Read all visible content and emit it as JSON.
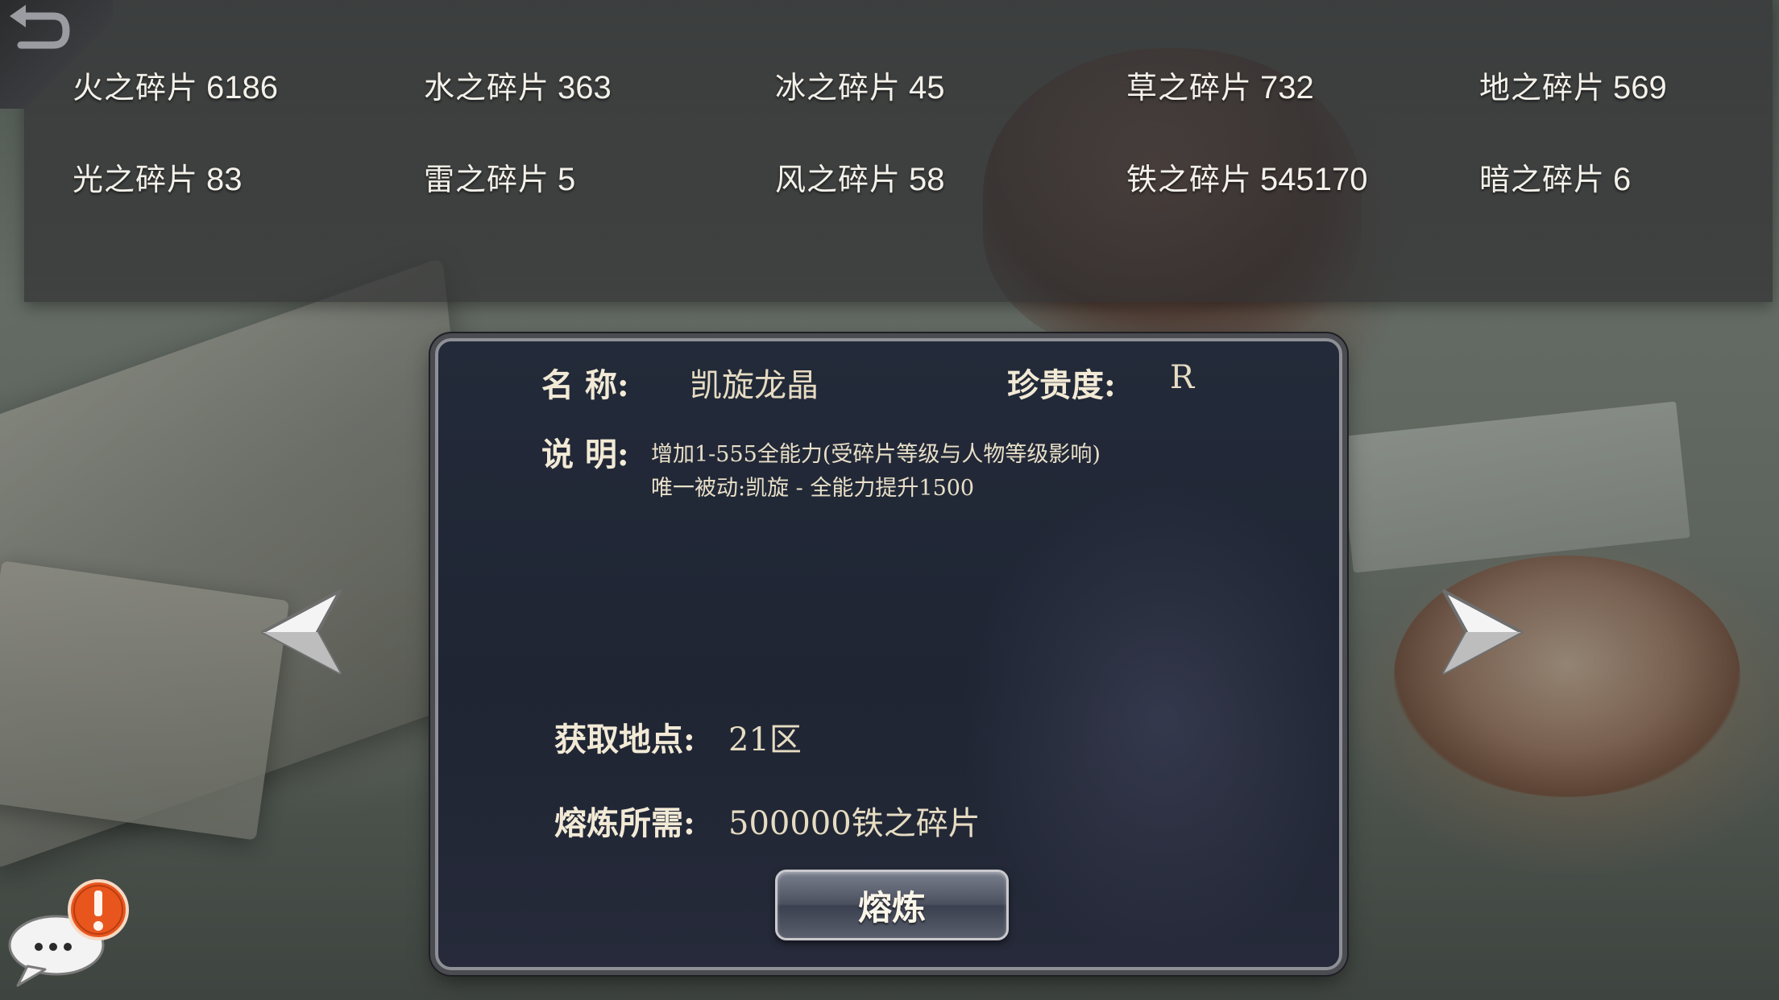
{
  "colors": {
    "panel_bg": "#222a38",
    "label_text": "#f2ead6",
    "value_text": "#e6dcc2",
    "fragment_text": "#f4f1ea",
    "alert_orange": "#e8561e"
  },
  "fragments": [
    {
      "name": "火之碎片",
      "count": "6186"
    },
    {
      "name": "水之碎片",
      "count": "363"
    },
    {
      "name": "冰之碎片",
      "count": "45"
    },
    {
      "name": "草之碎片",
      "count": "732"
    },
    {
      "name": "地之碎片",
      "count": "569"
    },
    {
      "name": "光之碎片",
      "count": "83"
    },
    {
      "name": "雷之碎片",
      "count": "5"
    },
    {
      "name": "风之碎片",
      "count": "58"
    },
    {
      "name": "铁之碎片",
      "count": "545170"
    },
    {
      "name": "暗之碎片",
      "count": "6"
    }
  ],
  "item": {
    "name_label": "名 称:",
    "name": "凯旋龙晶",
    "rarity_label": "珍贵度:",
    "rarity": "R",
    "desc_label": "说 明:",
    "desc_line1": "增加1-555全能力(受碎片等级与人物等级影响)",
    "desc_line2": "唯一被动:凯旋 - 全能力提升1500",
    "location_label": "获取地点:",
    "location": "21区",
    "cost_label": "熔炼所需:",
    "cost": "500000铁之碎片",
    "smelt_button": "熔炼"
  },
  "icons": {
    "back": "back-arrow-icon",
    "prev": "left-arrow-icon",
    "next": "right-arrow-icon",
    "chat": "chat-bubble-icon",
    "alert": "exclamation-icon"
  }
}
